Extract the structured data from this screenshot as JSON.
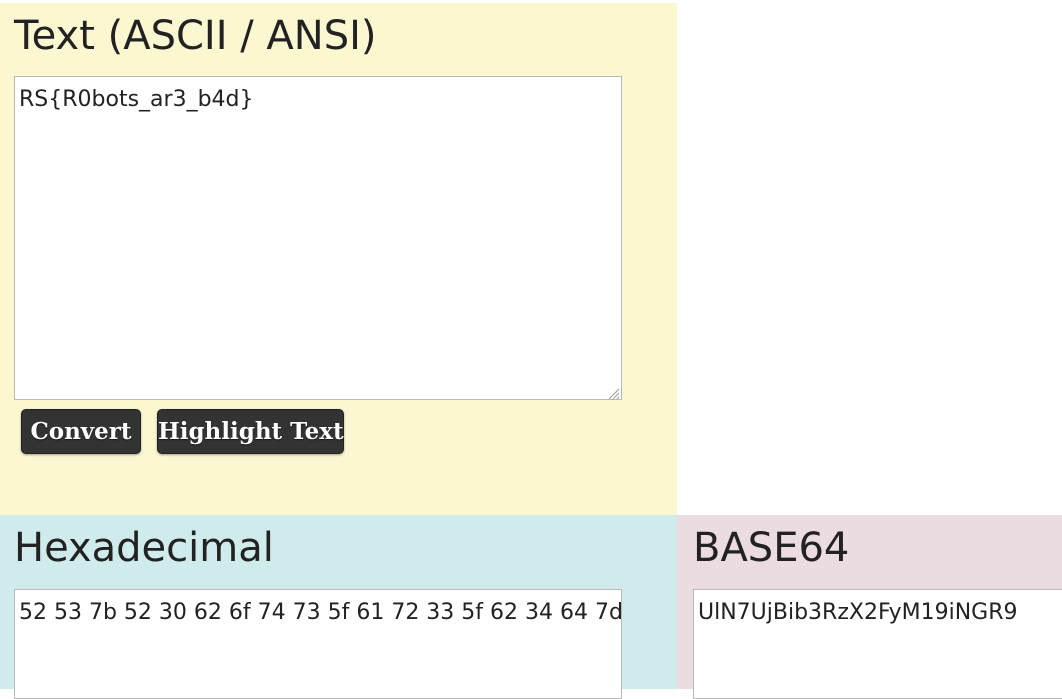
{
  "text_panel": {
    "title": "Text (ASCII / ANSI)",
    "value": "RS{R0bots_ar3_b4d}",
    "convert_label": "Convert",
    "highlight_label": "Highlight Text",
    "bg_color": "#faf7d1"
  },
  "hex_panel": {
    "title": "Hexadecimal",
    "value": "52 53 7b 52 30 62 6f 74 73 5f 61 72 33 5f 62 34 64 7d",
    "bg_color": "#cfebeb"
  },
  "base64_panel": {
    "title": "BASE64",
    "value": "UlN7UjBib3RzX2FyM19iNGR9",
    "bg_color": "#eadce0"
  },
  "button_color": "#333333"
}
